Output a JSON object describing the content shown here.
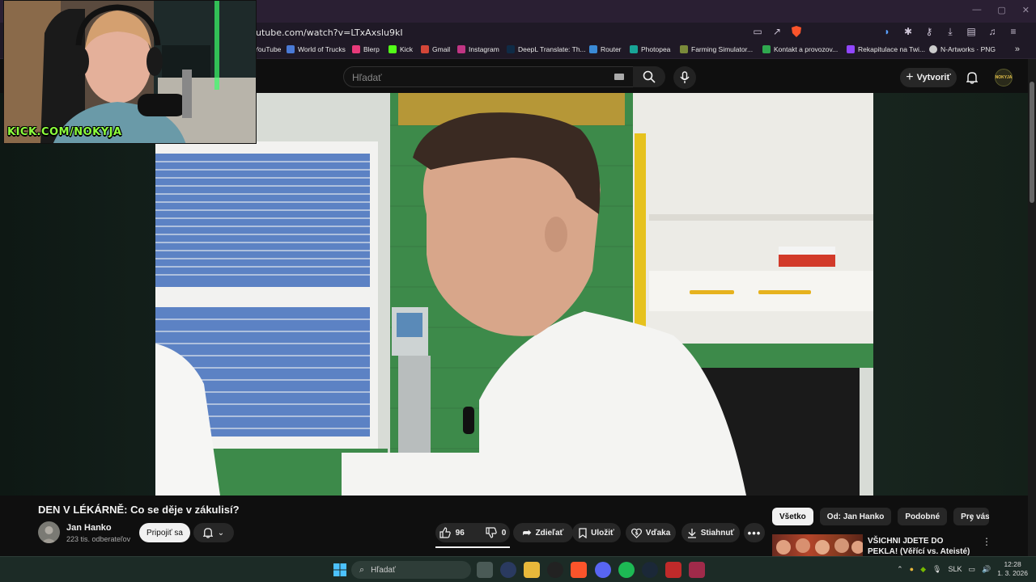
{
  "browser": {
    "url": "utube.com/watch?v=LTxAxslu9kI",
    "window_controls": [
      "—",
      "▢",
      "✕"
    ],
    "bookmarks": [
      {
        "label": "YouTube",
        "color": "#ff0000"
      },
      {
        "label": "World of Trucks",
        "color": "#4a7ad6"
      },
      {
        "label": "Blerp",
        "color": "#e83a7a"
      },
      {
        "label": "Kick",
        "color": "#53fc18"
      },
      {
        "label": "Gmail",
        "color": "#d44638"
      },
      {
        "label": "Instagram",
        "color": "#c13584"
      },
      {
        "label": "DeepL Translate: Th...",
        "color": "#0f2b46"
      },
      {
        "label": "Router",
        "color": "#3a8ad6"
      },
      {
        "label": "Photopea",
        "color": "#18a497"
      },
      {
        "label": "Farming Simulator...",
        "color": "#7a8a3a"
      },
      {
        "label": "Kontakt a provozov...",
        "color": "#2fa84f"
      },
      {
        "label": "Rekapitulace na Twi...",
        "color": "#9146ff"
      },
      {
        "label": "N-Artworks · PNG",
        "color": "#cccccc"
      }
    ],
    "more_label": "»"
  },
  "youtube": {
    "search_placeholder": "Hľadať",
    "create_label": "Vytvoriť",
    "account_badge": "NOKYJA"
  },
  "webcam": {
    "overlay_text": "KICK.COM/NOKYJA"
  },
  "video": {
    "title": "DEN V LÉKÁRNĚ: Co se děje v zákulisí?",
    "channel_name": "Jan Hanko",
    "subscribers": "223 tis. odberateľov",
    "join_label": "Pripojiť sa",
    "likes": "96",
    "dislikes": "0",
    "share_label": "Zdieľať",
    "save_label": "Uložiť",
    "thanks_label": "Vďaka",
    "download_label": "Stiahnuť"
  },
  "sidebar": {
    "chips": [
      "Všetko",
      "Od: Jan Hanko",
      "Podobné",
      "Pre vás"
    ],
    "active_chip": "Všetko",
    "recommendation": {
      "title": "VŠICHNI JDETE DO PEKLA! (Věřící vs. Ateisté)"
    }
  },
  "taskbar": {
    "search_placeholder": "Hľadať",
    "language": "SLK",
    "time": "12:28",
    "date": "1. 3. 2026"
  },
  "colors": {
    "accent_kick": "#53fc18",
    "youtube_bg": "#0f0f0f",
    "taskbar_bg": "#1c2b26"
  }
}
